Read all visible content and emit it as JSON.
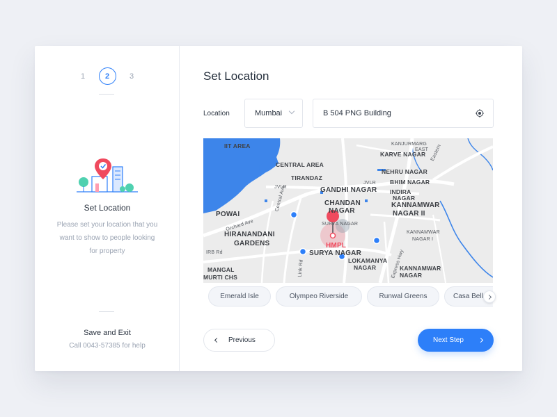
{
  "steps": [
    "1",
    "2",
    "3"
  ],
  "active_step": "2",
  "sidebar": {
    "title": "Set Location",
    "description": "Please set your location that you want to show to people looking for property",
    "save_exit": "Save and Exit",
    "help": "Call 0043-57385 for help"
  },
  "main": {
    "title": "Set Location",
    "location_label": "Location",
    "city_value": "Mumbai",
    "address_value": "B 504 PNG Building"
  },
  "map": {
    "labels": [
      "IIT AREA",
      "CENTRAL AREA",
      "TIRANDAZ",
      "JVLR",
      "JVLR",
      "GANDHI NAGAR",
      "CHANDAN",
      "NAGAR",
      "POWAI",
      "Orchard Ave",
      "Central Ave",
      "HIRANANDANI",
      "GARDENS",
      "SURYA NAGAR",
      "HMPL",
      "SURYA NAGAR",
      "LOKAMANYA",
      "NAGAR",
      "MANGAL",
      "MURTI CHS",
      "IRB Rd",
      "Link Rd",
      "Express Hwy",
      "KANJURMARG",
      "EAST",
      "KARVE NAGAR",
      "NEHRU NAGAR",
      "BHIM NAGAR",
      "INDIRA",
      "NAGAR",
      "KANNAMWAR",
      "NAGAR II",
      "KANNAMWAR",
      "NAGAR I",
      "KANNAMWAR",
      "NAGAR",
      "Eastern"
    ],
    "pin": "location-pin"
  },
  "suggestions": [
    "Emerald Isle",
    "Olympeo Riverside",
    "Runwal Greens",
    "Casa Bella"
  ],
  "buttons": {
    "previous": "Previous",
    "next": "Next Step"
  },
  "colors": {
    "accent": "#2d7ff9",
    "pin": "#f04a5e",
    "water": "#3d85ea"
  }
}
